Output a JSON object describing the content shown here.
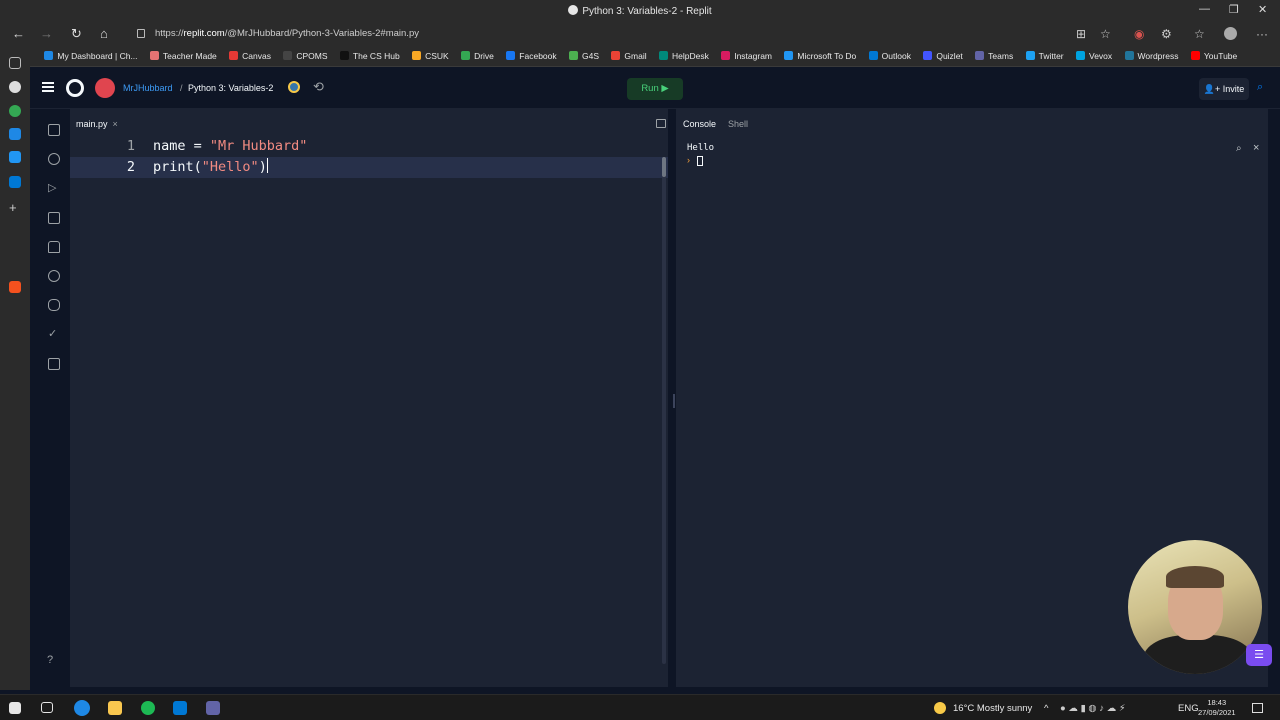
{
  "window": {
    "title": "Python 3: Variables-2 - Replit"
  },
  "browser": {
    "url_prefix": "https://",
    "url_domain": "replit.com",
    "url_path": "/@MrJHubbard/Python-3-Variables-2#main.py",
    "bookmarks": [
      {
        "label": "My Dashboard | Ch...",
        "color": "#1e88e5"
      },
      {
        "label": "Teacher Made",
        "color": "#e57373"
      },
      {
        "label": "Canvas",
        "color": "#e53935"
      },
      {
        "label": "CPOMS",
        "color": "#444444"
      },
      {
        "label": "The CS Hub",
        "color": "#222222"
      },
      {
        "label": "CSUK",
        "color": "#f9a825"
      },
      {
        "label": "Drive",
        "color": "#34a853"
      },
      {
        "label": "Facebook",
        "color": "#1877f2"
      },
      {
        "label": "G4S",
        "color": "#4caf50"
      },
      {
        "label": "Gmail",
        "color": "#ea4335"
      },
      {
        "label": "HelpDesk",
        "color": "#00897b"
      },
      {
        "label": "Instagram",
        "color": "#d81b60"
      },
      {
        "label": "Microsoft To Do",
        "color": "#2196f3"
      },
      {
        "label": "Outlook",
        "color": "#0078d4"
      },
      {
        "label": "Quizlet",
        "color": "#4255ff"
      },
      {
        "label": "Teams",
        "color": "#6264a7"
      },
      {
        "label": "Twitter",
        "color": "#1da1f2"
      },
      {
        "label": "Vevox",
        "color": "#00a3e0"
      },
      {
        "label": "Wordpress",
        "color": "#21759b"
      },
      {
        "label": "YouTube",
        "color": "#ff0000"
      }
    ]
  },
  "replit": {
    "user": "MrJHubbard",
    "separator": "/",
    "repl_name": "Python 3: Variables-2",
    "run_label": "Run ▶",
    "invite_label": "Invite",
    "invite_icon": "👤+",
    "help_label": "?"
  },
  "editor": {
    "file_tab": "main.py",
    "close_glyph": "×",
    "lines": [
      {
        "num": "1",
        "before": "name = ",
        "string": "\"Mr Hubbard\"",
        "after": ""
      },
      {
        "num": "2",
        "before": "print(",
        "string": "\"Hello\"",
        "after": ")"
      }
    ]
  },
  "console": {
    "tabs": [
      "Console",
      "Shell"
    ],
    "output": "Hello",
    "prompt": "›",
    "close_glyph": "×"
  },
  "taskbar": {
    "weather": "16°C  Mostly sunny",
    "language": "ENG",
    "time": "18:43",
    "date": "27/09/2021"
  },
  "colors": {
    "accent_run": "#48d17a",
    "string": "#f28b82",
    "background": "#0e1525",
    "panel": "#1c2333"
  }
}
